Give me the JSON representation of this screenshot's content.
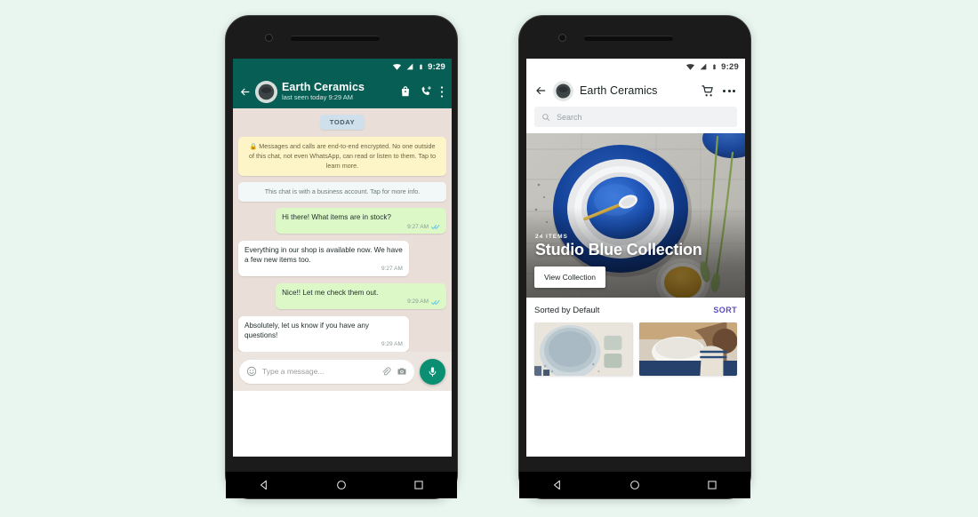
{
  "background_color": "#e9f5ef",
  "left_phone": {
    "name": "whatsapp-chat-phone",
    "status_bar": {
      "time": "9:29",
      "icons": [
        "wifi-icon",
        "signal-icon",
        "battery-icon"
      ]
    },
    "header": {
      "back_icon": "back-arrow-icon",
      "avatar": "shop-avatar",
      "title": "Earth Ceramics",
      "subtitle": "last seen today 9:29 AM",
      "actions": [
        "shopping-bag-icon",
        "video-call-add-icon",
        "overflow-menu-icon"
      ],
      "background_color": "#075e54"
    },
    "day_chip": "TODAY",
    "system_messages": [
      {
        "type": "encryption",
        "text": "Messages and calls are end-to-end encrypted. No one outside of this chat, not even WhatsApp, can read or listen to them. Tap to learn more.",
        "has_lock_icon": true,
        "background_color": "#fdf4c8"
      },
      {
        "type": "business",
        "text": "This chat is with a business account. Tap for more info.",
        "has_lock_icon": false,
        "background_color": "#f2f8f8"
      }
    ],
    "messages": [
      {
        "direction": "out",
        "text": "Hi there! What items are in stock?",
        "time": "9:27 AM",
        "status": "read"
      },
      {
        "direction": "in",
        "text": "Everything in our shop is available now. We have a few new items too.",
        "time": "9:27 AM",
        "status": ""
      },
      {
        "direction": "out",
        "text": "Nice!! Let me check them out.",
        "time": "9:29 AM",
        "status": "read"
      },
      {
        "direction": "in",
        "text": "Absolutely, let us know if you have any questions!",
        "time": "9:29 AM",
        "status": ""
      }
    ],
    "input_bar": {
      "emoji_icon": "emoji-icon",
      "placeholder": "Type a message...",
      "attach_icon": "paperclip-icon",
      "camera_icon": "camera-icon",
      "mic_icon": "microphone-icon",
      "mic_color": "#0a8f72"
    },
    "nav_bar": [
      "back-triangle-icon",
      "home-circle-icon",
      "recents-square-icon"
    ]
  },
  "right_phone": {
    "name": "catalog-phone",
    "status_bar": {
      "time": "9:29",
      "icons": [
        "wifi-icon",
        "signal-icon",
        "battery-icon"
      ]
    },
    "header": {
      "back_icon": "back-arrow-icon",
      "avatar": "shop-avatar",
      "title": "Earth Ceramics",
      "actions": [
        "shopping-cart-icon",
        "overflow-menu-horizontal-icon"
      ],
      "background_color": "#ffffff"
    },
    "search": {
      "icon": "search-icon",
      "placeholder": "Search",
      "value": ""
    },
    "hero": {
      "items_count": "24 ITEMS",
      "title": "Studio Blue Collection",
      "button_label": "View Collection",
      "image_alt": "stacked blue and white ceramic bowls with gold spoon"
    },
    "sort_row": {
      "label": "Sorted by Default",
      "action": "SORT",
      "action_color": "#5b4bc4"
    },
    "products": [
      {
        "alt": "light blue speckled bowl with two cups"
      },
      {
        "alt": "person holding white ceramic bowl"
      }
    ],
    "nav_bar": [
      "back-triangle-icon",
      "home-circle-icon",
      "recents-square-icon"
    ]
  }
}
